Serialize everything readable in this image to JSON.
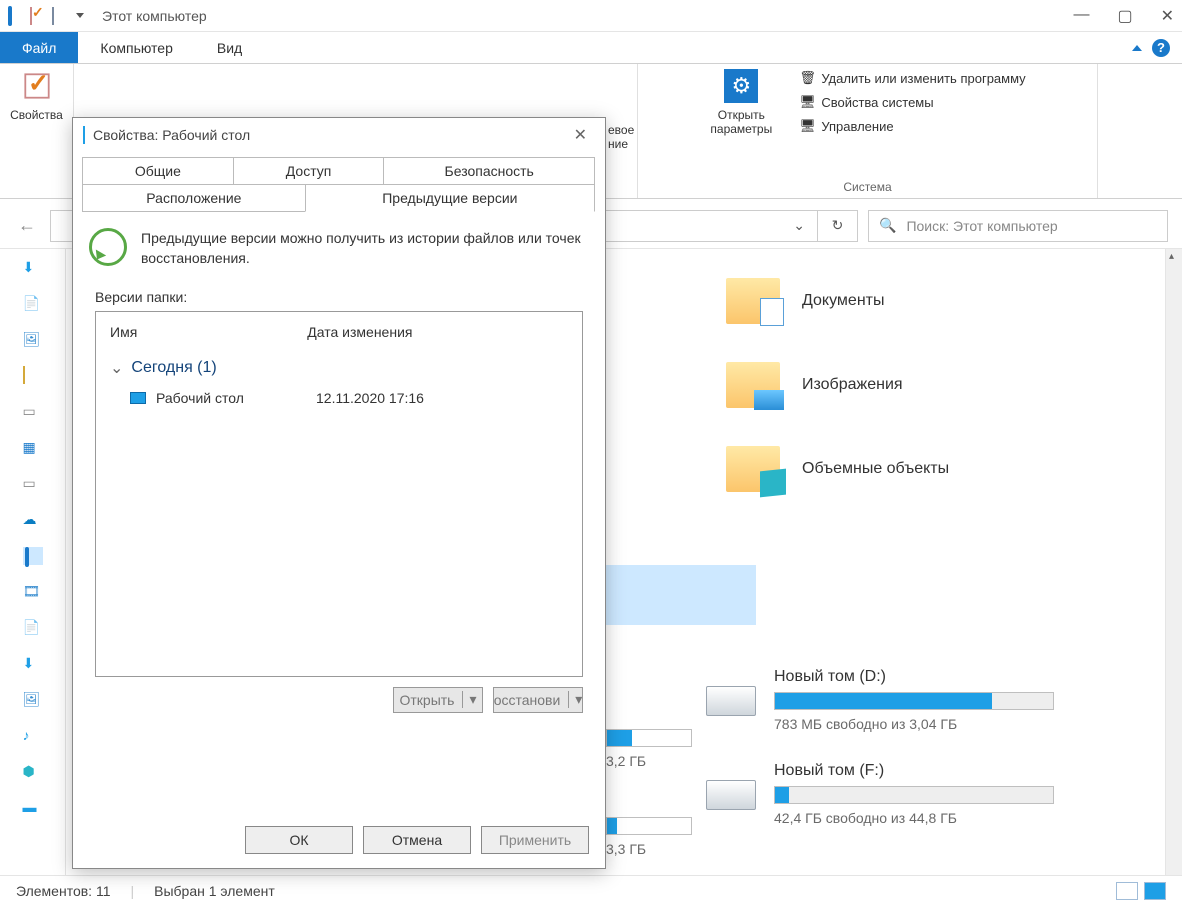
{
  "titlebar": {
    "title": "Этот компьютер"
  },
  "tabs": {
    "file": "Файл",
    "computer": "Компьютер",
    "view": "Вид"
  },
  "ribbon": {
    "props_btn": "Свойства",
    "open_params": "Открыть\nпараметры",
    "grp_peek_net": "евое",
    "grp_peek_net2": "ние",
    "delete_prog": "Удалить или изменить программу",
    "sys_props": "Свойства системы",
    "manage": "Управление",
    "group_system": "Система"
  },
  "addr": {
    "dropdown": "",
    "search_placeholder": "Поиск: Этот компьютер"
  },
  "folders": [
    {
      "name": "Документы",
      "kind": "doc"
    },
    {
      "name": "Изображения",
      "kind": "img"
    },
    {
      "name": "Объемные объекты",
      "kind": "obj"
    }
  ],
  "drives": [
    {
      "name": "Новый том (D:)",
      "free": "783 МБ свободно из 3,04 ГБ",
      "pct": 78,
      "partial_size": "3,2 ГБ"
    },
    {
      "name": "Новый том (F:)",
      "free": "42,4 ГБ свободно из 44,8 ГБ",
      "pct": 5,
      "partial_size": "3,3 ГБ"
    }
  ],
  "status": {
    "count": "Элементов: 11",
    "selected": "Выбран 1 элемент"
  },
  "props": {
    "title": "Свойства: Рабочий стол",
    "tabs": {
      "general": "Общие",
      "sharing": "Доступ",
      "security": "Безопасность",
      "location": "Расположение",
      "prev": "Предыдущие версии"
    },
    "desc": "Предыдущие версии можно получить из истории файлов или точек восстановления.",
    "versions_label": "Версии папки:",
    "col_name": "Имя",
    "col_date": "Дата изменения",
    "group": "Сегодня (1)",
    "item": {
      "name": "Рабочий стол",
      "date": "12.11.2020 17:16"
    },
    "btn_open": "Открыть",
    "btn_restore": "осстанови",
    "btn_ok": "ОК",
    "btn_cancel": "Отмена",
    "btn_apply": "Применить"
  }
}
